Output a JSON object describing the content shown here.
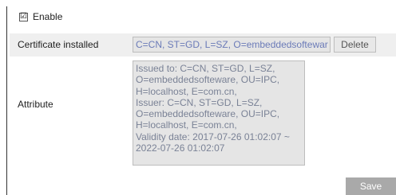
{
  "enable": {
    "label": "Enable",
    "checked": true,
    "check_glyph": "☑"
  },
  "certificate": {
    "label": "Certificate installed",
    "value": "C=CN, ST=GD, L=SZ, O=embeddedsoftewar",
    "delete_label": "Delete"
  },
  "attribute": {
    "label": "Attribute",
    "lines": [
      "Issued to: C=CN, ST=GD, L=SZ,",
      "O=embeddedsofteware, OU=IPC,",
      "H=localhost, E=com.cn,",
      "Issuer: C=CN, ST=GD, L=SZ,",
      "O=embeddedsofteware, OU=IPC,",
      "H=localhost, E=com.cn,",
      "Validity date: 2017-07-26 01:02:07 ~",
      "2022-07-26 01:02:07"
    ]
  },
  "save_label": "Save"
}
